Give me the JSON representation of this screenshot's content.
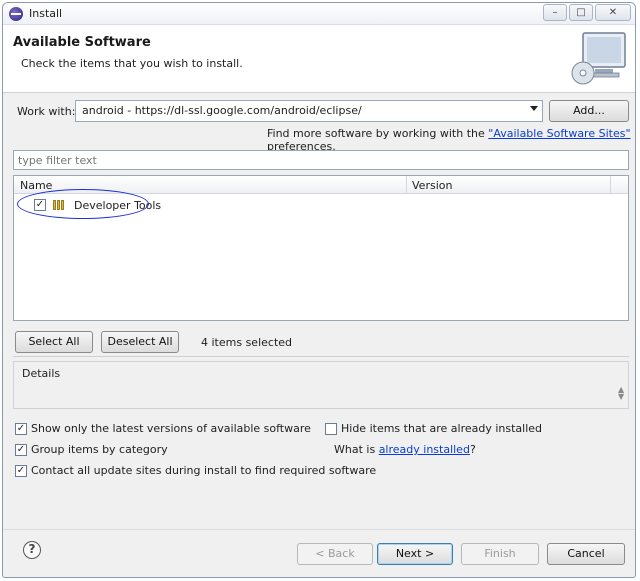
{
  "window": {
    "title": "Install",
    "minimize": "–",
    "maximize": "□",
    "close": "✕"
  },
  "banner": {
    "title": "Available Software",
    "subtitle": "Check the items that you wish to install.",
    "icon": "monitor-cd-icon"
  },
  "work_with": {
    "label": "Work with:",
    "value": "android - https://dl-ssl.google.com/android/eclipse/",
    "add_label": "Add...",
    "find_more_prefix": "Find more software by working with the ",
    "find_more_link": "\"Available Software Sites\"",
    "find_more_suffix": " preferences."
  },
  "filter": {
    "placeholder": "type filter text"
  },
  "tree": {
    "columns": [
      "Name",
      "Version"
    ],
    "items": [
      {
        "label": "Developer Tools",
        "checked": true,
        "icon": "category-icon"
      }
    ]
  },
  "selection": {
    "select_all": "Select All",
    "deselect_all": "Deselect All",
    "count_text": "4 items selected"
  },
  "details": {
    "label": "Details"
  },
  "options": {
    "show_latest": {
      "label": "Show only the latest versions of available software",
      "checked": true
    },
    "group_by_category": {
      "label": "Group items by category",
      "checked": true
    },
    "contact_sites": {
      "label": "Contact all update sites during install to find required software",
      "checked": true
    },
    "hide_installed": {
      "label": "Hide items that are already installed",
      "checked": false
    },
    "what_is_prefix": "What is ",
    "what_is_link": "already installed",
    "what_is_suffix": "?"
  },
  "footer": {
    "help": "?",
    "back": "< Back",
    "next": "Next >",
    "finish": "Finish",
    "cancel": "Cancel"
  },
  "colors": {
    "annotation_circle": "#1f2fd8",
    "link": "#0a3dcf"
  }
}
